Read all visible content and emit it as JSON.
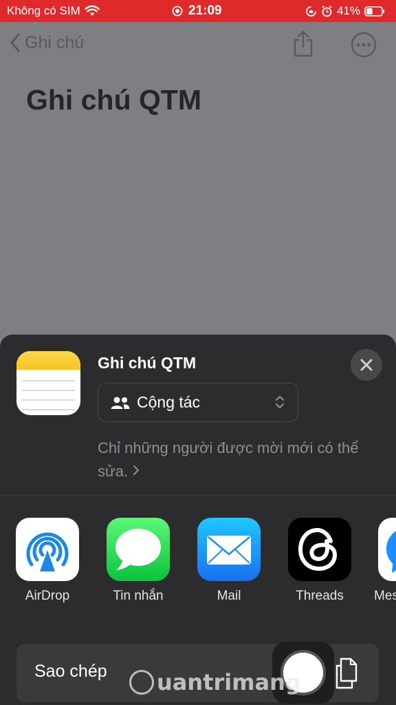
{
  "status_bar": {
    "carrier": "Không có SIM",
    "time": "21:09",
    "battery": "41%",
    "battery_level": 0.41
  },
  "nav": {
    "back_label": "Ghi chú"
  },
  "note": {
    "title": "Ghi chú QTM"
  },
  "share_sheet": {
    "title": "Ghi chú QTM",
    "collab_label": "Cộng tác",
    "description": "Chỉ những người được mời mới có thể sửa.",
    "apps": [
      {
        "label": "AirDrop",
        "icon": "airdrop-icon"
      },
      {
        "label": "Tin nhắn",
        "icon": "messages-icon"
      },
      {
        "label": "Mail",
        "icon": "mail-icon"
      },
      {
        "label": "Threads",
        "icon": "threads-icon"
      },
      {
        "label": "Mes",
        "icon": "messenger-icon"
      }
    ],
    "copy_label": "Sao chép"
  },
  "watermark": {
    "text": "uantrimang"
  },
  "colors": {
    "status_bar_bg": "#e0292b",
    "sheet_bg": "#2c2c2e",
    "dim_bg": "#7f7e82"
  }
}
